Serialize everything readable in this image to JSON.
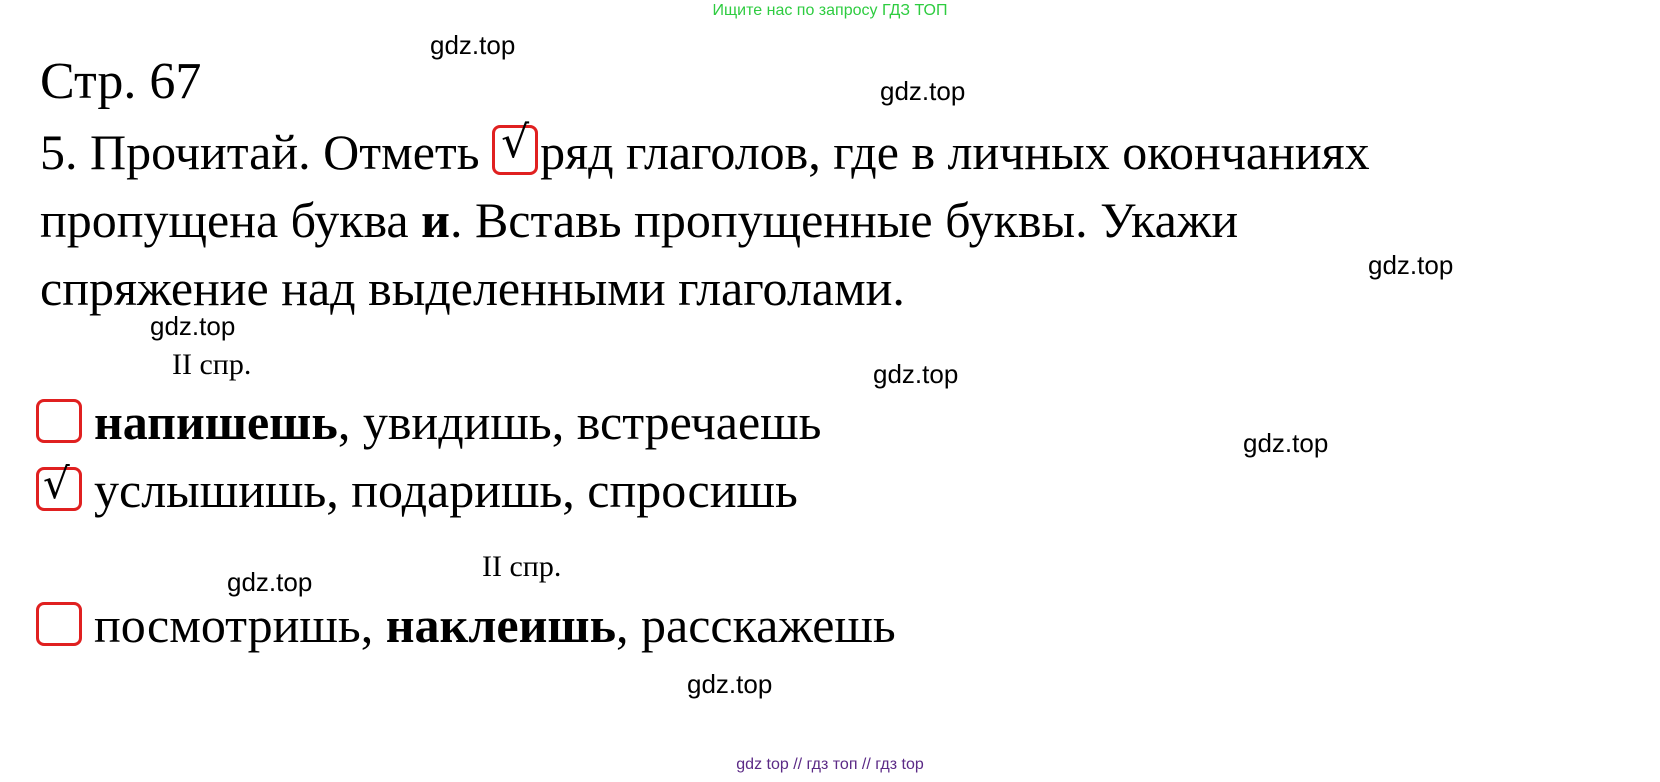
{
  "banner": "Ищите нас по запросу ГДЗ ТОП",
  "watermark": "gdz.top",
  "page_title": "Стр. 67",
  "task": {
    "line1_before": "5. Прочитай. Отметь ",
    "check_mark": "√",
    "line1_after": "ряд глаголов, где в личных окончаниях",
    "line2_before": "пропущена буква ",
    "line2_bold": "и",
    "line2_after": ". Вставь пропущенные буквы. Укажи",
    "line3": "спряжение над выделенными глаголами."
  },
  "conjugation_label": "II спр.",
  "options": [
    {
      "checked": false,
      "bold": "напишешь",
      "rest": ", увидишь, встречаешь"
    },
    {
      "checked": true,
      "check_mark": "√",
      "rest": "услышишь, подаришь, спросишь"
    },
    {
      "checked": false,
      "plain": "посмотришь, ",
      "bold": "наклеишь",
      "rest": ", расскажешь"
    }
  ],
  "footer": "gdz top  //  гдз топ  //  гдз top",
  "colors": {
    "banner": "#2ecc40",
    "checkbox_border": "#e02020",
    "footer": "#5b2a86"
  }
}
